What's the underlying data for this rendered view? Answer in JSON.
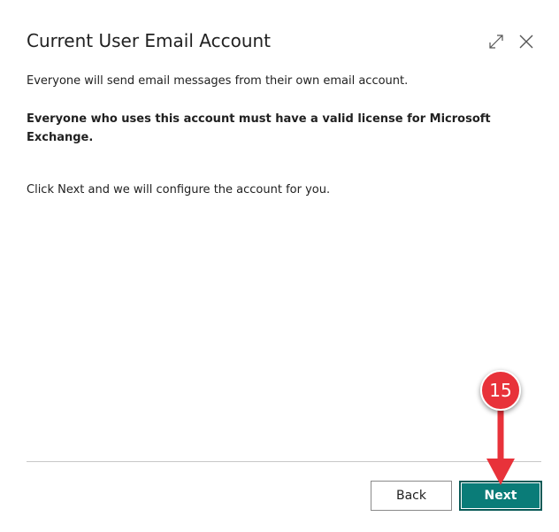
{
  "dialog": {
    "title": "Current User Email Account",
    "expand_icon": "expand-icon",
    "close_icon": "close-icon"
  },
  "content": {
    "line1": "Everyone will send email messages from their own email account.",
    "warning": "Everyone who uses this account must have a valid license for Microsoft Exchange.",
    "line3": "Click Next and we will configure the account for you."
  },
  "footer": {
    "back_label": "Back",
    "next_label": "Next"
  },
  "annotation": {
    "step_number": "15",
    "color": "#e8323a"
  },
  "colors": {
    "primary_button": "#0a7c78"
  }
}
